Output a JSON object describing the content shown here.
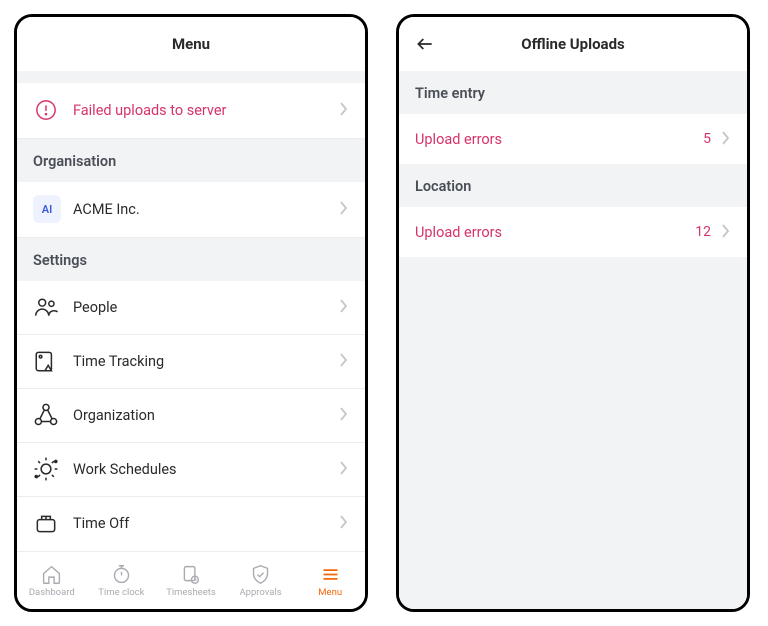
{
  "left": {
    "header": {
      "title": "Menu"
    },
    "alert_label": "Failed uploads to server",
    "sections": {
      "organisation": {
        "header": "Organisation",
        "badge": "AI",
        "name": "ACME Inc."
      },
      "settings": {
        "header": "Settings",
        "items": [
          {
            "label": "People"
          },
          {
            "label": "Time Tracking"
          },
          {
            "label": "Organization"
          },
          {
            "label": "Work Schedules"
          },
          {
            "label": "Time Off"
          }
        ]
      }
    },
    "tabs": [
      {
        "label": "Dashboard"
      },
      {
        "label": "Time clock"
      },
      {
        "label": "Timesheets"
      },
      {
        "label": "Approvals"
      },
      {
        "label": "Menu"
      }
    ]
  },
  "right": {
    "header": {
      "title": "Offline Uploads"
    },
    "sections": {
      "time_entry": {
        "header": "Time entry",
        "row_label": "Upload errors",
        "count": "5"
      },
      "location": {
        "header": "Location",
        "row_label": "Upload errors",
        "count": "12"
      }
    }
  },
  "colors": {
    "accent_pink": "#d6336c",
    "accent_orange": "#f76707"
  }
}
